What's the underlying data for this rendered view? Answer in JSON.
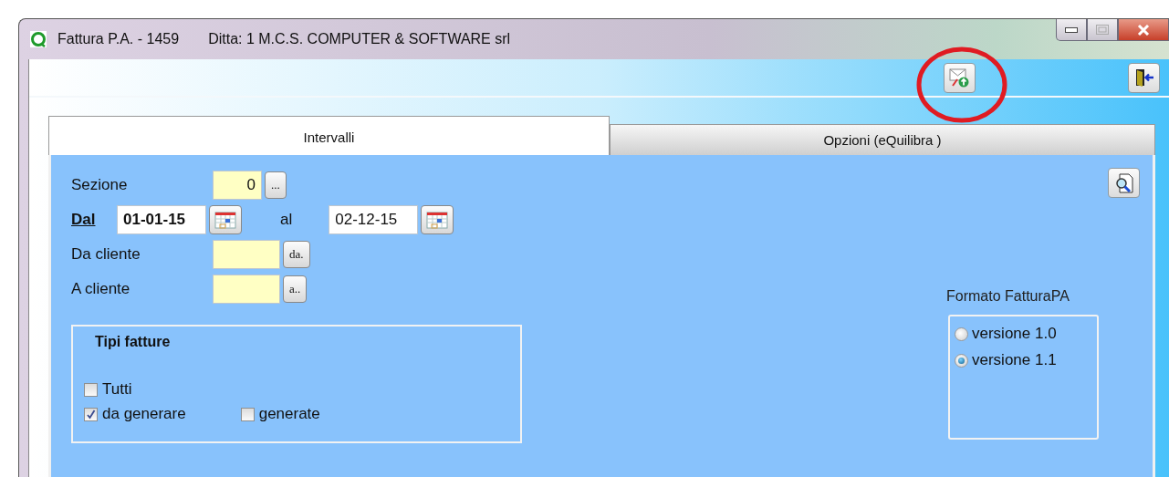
{
  "window": {
    "title": "Fattura P.A. - 1459",
    "company": "Ditta: 1  M.C.S. COMPUTER & SOFTWARE srl"
  },
  "tabs": [
    {
      "label": "Intervalli",
      "selected": true
    },
    {
      "label": "Opzioni (eQuilibra )",
      "selected": false
    }
  ],
  "fields": [
    {
      "kind": "lookup",
      "label": "Sezione",
      "value": "0",
      "button": "..."
    },
    {
      "kind": "daterange",
      "label": "Dal",
      "value": "01-01-15",
      "to_label": "al",
      "to_value": "02-12-15"
    },
    {
      "kind": "client",
      "label": "Da cliente",
      "button": "da."
    },
    {
      "kind": "client",
      "label": "A cliente",
      "button": "a.."
    }
  ],
  "invoice_types": {
    "title": "Tipi fatture",
    "checkboxes": [
      {
        "label": "Tutti",
        "checked": false
      },
      {
        "label": "da generare",
        "checked": true
      },
      {
        "label": "generate",
        "checked": false
      }
    ]
  },
  "format": {
    "title": "Formato FatturaPA",
    "options": [
      {
        "label": "versione 1.0",
        "selected": false
      },
      {
        "label": "versione 1.1",
        "selected": true
      }
    ]
  }
}
